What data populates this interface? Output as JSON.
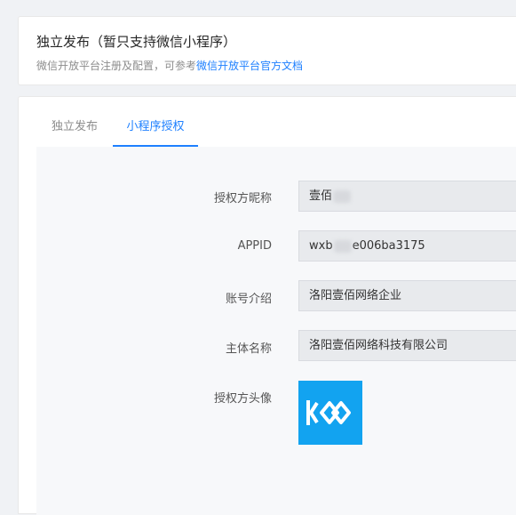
{
  "header": {
    "title": "独立发布（暂只支持微信小程序）",
    "desc_prefix": "微信开放平台注册及配置，可参考",
    "desc_link": "微信开放平台官方文档"
  },
  "tabs": [
    {
      "label": "独立发布",
      "active": false
    },
    {
      "label": "小程序授权",
      "active": true
    }
  ],
  "form": {
    "nickname": {
      "label": "授权方昵称",
      "value_visible": "壹佰"
    },
    "appid": {
      "label": "APPID",
      "value_prefix": "wxb",
      "value_suffix": "e006ba3175"
    },
    "intro": {
      "label": "账号介绍",
      "value": "洛阳壹佰网络企业"
    },
    "subject": {
      "label": "主体名称",
      "value": "洛阳壹佰网络科技有限公司"
    },
    "avatar": {
      "label": "授权方头像",
      "icon": "brand-logo-icon",
      "bg_color": "#12a3f0"
    }
  },
  "colors": {
    "accent": "#1e80ff"
  }
}
